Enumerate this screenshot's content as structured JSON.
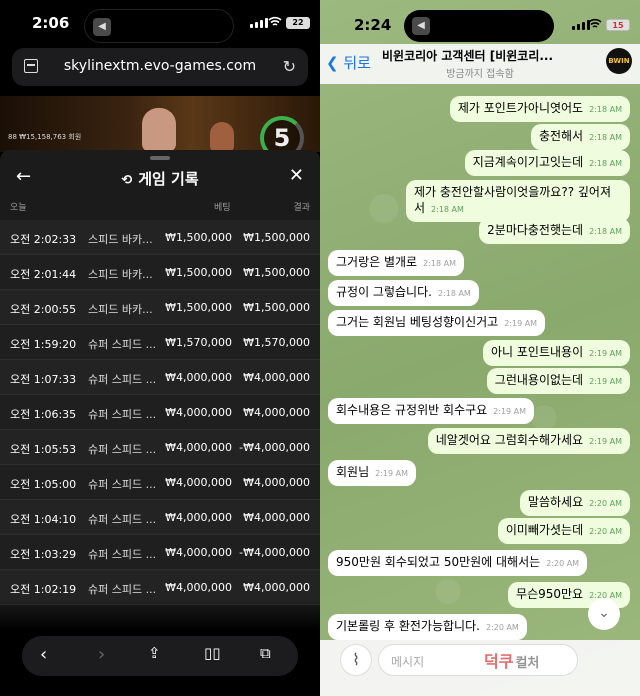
{
  "left": {
    "status": {
      "time": "2:06",
      "battery": "22"
    },
    "url": "skylinextm.evo-games.com",
    "video": {
      "info": "88  ₩15,158,763 회원",
      "countdown": "5"
    },
    "sheet": {
      "title": "게임 기록",
      "columns": {
        "date": "오늘",
        "bet": "베팅",
        "result": "결과"
      },
      "rows": [
        {
          "time": "오전 2:02:33",
          "game": "스피드 바카...",
          "bet": "₩1,500,000",
          "result": "₩1,500,000"
        },
        {
          "time": "오전 2:01:44",
          "game": "스피드 바카...",
          "bet": "₩1,500,000",
          "result": "₩1,500,000"
        },
        {
          "time": "오전 2:00:55",
          "game": "스피드 바카...",
          "bet": "₩1,500,000",
          "result": "₩1,500,000"
        },
        {
          "time": "오전 1:59:20",
          "game": "슈퍼 스피드 ...",
          "bet": "₩1,570,000",
          "result": "₩1,570,000"
        },
        {
          "time": "오전 1:07:33",
          "game": "슈퍼 스피드 ...",
          "bet": "₩4,000,000",
          "result": "₩4,000,000"
        },
        {
          "time": "오전 1:06:35",
          "game": "슈퍼 스피드 ...",
          "bet": "₩4,000,000",
          "result": "₩4,000,000"
        },
        {
          "time": "오전 1:05:53",
          "game": "슈퍼 스피드 ...",
          "bet": "₩4,000,000",
          "result": "-₩4,000,000"
        },
        {
          "time": "오전 1:05:00",
          "game": "슈퍼 스피드 ...",
          "bet": "₩4,000,000",
          "result": "₩4,000,000"
        },
        {
          "time": "오전 1:04:10",
          "game": "슈퍼 스피드 ...",
          "bet": "₩4,000,000",
          "result": "₩4,000,000"
        },
        {
          "time": "오전 1:03:29",
          "game": "슈퍼 스피드 ...",
          "bet": "₩4,000,000",
          "result": "-₩4,000,000"
        },
        {
          "time": "오전 1:02:19",
          "game": "슈퍼 스피드 ...",
          "bet": "₩4,000,000",
          "result": "₩4,000,000"
        }
      ]
    }
  },
  "right": {
    "status": {
      "time": "2:24",
      "battery": "15"
    },
    "header": {
      "back": "뒤로",
      "name": "비윈코리아 고객센터 [비윈코리...",
      "sub": "방금까지 접속함",
      "avatar": "BWIN"
    },
    "messages": [
      {
        "dir": "out",
        "text": "제가 포인트가아니엿어도",
        "time": "2:18 AM"
      },
      {
        "dir": "out",
        "text": "충전해서",
        "time": "2:18 AM"
      },
      {
        "dir": "out",
        "text": "지금계속이기고잇는데",
        "time": "2:18 AM"
      },
      {
        "dir": "out",
        "text": "제가 충전안할사람이엇을까요?? 깊어져서",
        "time": "2:18 AM"
      },
      {
        "dir": "out",
        "text": "2분마다충전햇는데",
        "time": "2:18 AM"
      },
      {
        "dir": "in",
        "text": "그거랑은 별개로",
        "time": "2:18 AM"
      },
      {
        "dir": "in",
        "text": "규정이 그렇습니다.",
        "time": "2:18 AM"
      },
      {
        "dir": "in",
        "text": "그거는 회원님 베팅성향이신거고",
        "time": "2:19 AM"
      },
      {
        "dir": "out",
        "text": "아니 포인트내용이",
        "time": "2:19 AM"
      },
      {
        "dir": "out",
        "text": "그런내용이없는데",
        "time": "2:19 AM"
      },
      {
        "dir": "in",
        "text": "회수내용은 규정위반 회수구요",
        "time": "2:19 AM"
      },
      {
        "dir": "out",
        "text": "네알겟어요 그럼회수해가세요",
        "time": "2:19 AM"
      },
      {
        "dir": "in",
        "text": "회원님",
        "time": "2:19 AM"
      },
      {
        "dir": "out",
        "text": "말씀하세요",
        "time": "2:20 AM"
      },
      {
        "dir": "out",
        "text": "이미빼가셧는데",
        "time": "2:20 AM"
      },
      {
        "dir": "in",
        "text": "950만원 회수되었고 50만원에 대해서는",
        "time": "2:20 AM"
      },
      {
        "dir": "out",
        "text": "무슨950만요",
        "time": "2:20 AM"
      },
      {
        "dir": "in",
        "text": "기본롤링 후 환전가능합니다.",
        "time": "2:20 AM"
      }
    ],
    "input_placeholder": "메시지",
    "watermark": {
      "main": "덕쿠",
      "sub": "컬처"
    }
  }
}
